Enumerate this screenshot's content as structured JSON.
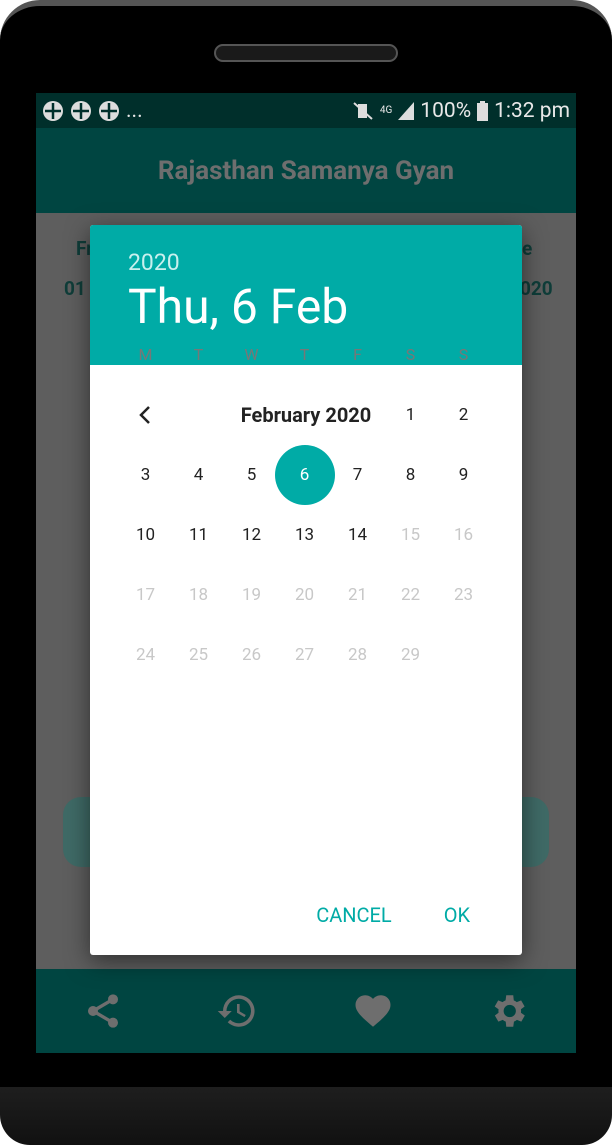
{
  "status_bar": {
    "notification_icons": [
      "app-icon",
      "app-icon",
      "app-icon"
    ],
    "more": "...",
    "battery": "100%",
    "network": "4G",
    "time": "1:32 pm"
  },
  "app_bar": {
    "title": "Rajasthan Samanya Gyan"
  },
  "background_fragments": {
    "left_label": "Fr",
    "left_value": "01",
    "right_label": "e",
    "right_value": "020"
  },
  "date_picker": {
    "header_year": "2020",
    "header_date": "Thu, 6 Feb",
    "month_title": "February 2020",
    "weekdays": [
      "M",
      "T",
      "W",
      "T",
      "F",
      "S",
      "S"
    ],
    "weeks": [
      [
        "",
        "",
        "",
        "",
        "",
        "1",
        "2"
      ],
      [
        "3",
        "4",
        "5",
        "6",
        "7",
        "8",
        "9"
      ],
      [
        "10",
        "11",
        "12",
        "13",
        "14",
        "15",
        "16"
      ],
      [
        "17",
        "18",
        "19",
        "20",
        "21",
        "22",
        "23"
      ],
      [
        "24",
        "25",
        "26",
        "27",
        "28",
        "29",
        ""
      ]
    ],
    "selected": "6",
    "enabled_max": 14,
    "cancel_label": "CANCEL",
    "ok_label": "OK",
    "accent_color": "#00aba6"
  },
  "bottom_nav": [
    "share-icon",
    "history-icon",
    "heart-icon",
    "gear-icon"
  ]
}
